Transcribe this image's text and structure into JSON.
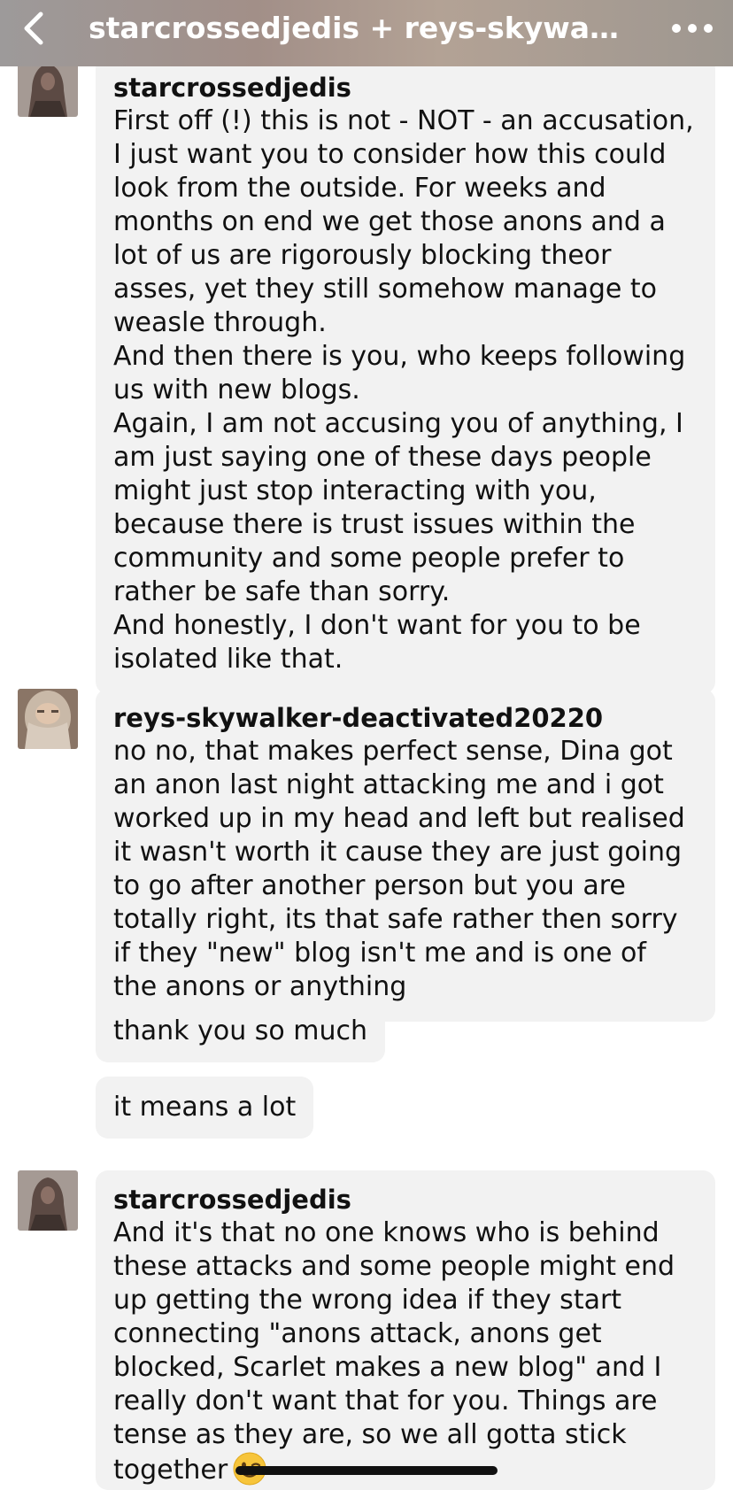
{
  "header": {
    "title": "starcrossedjedis + reys-skywalker-d...",
    "back_icon": "chevron-left-icon",
    "more_icon": "ellipsis-icon"
  },
  "messages": [
    {
      "sender": "starcrossedjedis",
      "avatar_icon": "hooded-figure-avatar",
      "text": "First off (!) this is not - NOT - an accusation, I just want you to consider how this could look from the outside. For weeks and months on end we get those anons and a lot of us are rigorously blocking theor asses, yet they still somehow manage to weasle through.\nAnd then there is you, who keeps following us with new blogs.\nAgain, I am not accusing you of anything, I am just saying one of these days people might just stop interacting with you, because there is trust issues within the community and some people prefer to rather be safe than sorry.\nAnd honestly, I don't want for you to be isolated like that."
    },
    {
      "sender": "reys-skywalker-deactivated20220",
      "avatar_icon": "veiled-face-avatar",
      "text": "no no, that makes perfect sense, Dina got an anon last night attacking me and i got worked up in my head and left but realised it wasn't worth it cause they are just going to go after another person but you are totally right, its that safe rather then sorry if they \"new\" blog isn't me and is one of the anons or anything"
    },
    {
      "text": "thank you so much"
    },
    {
      "text": "it means a lot"
    },
    {
      "sender": "starcrossedjedis",
      "avatar_icon": "hooded-figure-avatar",
      "text": "And it's that no one knows who is behind these attacks and some people might end up getting the wrong idea if they start connecting \"anons attack, anons get blocked, Scarlet makes a new blog\" and I really don't want that for you. Things are tense as they are, so we all gotta stick together",
      "emoji": "winking-face-emoji"
    }
  ],
  "colors": {
    "bubble": "#f2f2f2",
    "text": "#111111",
    "header_text": "#ffffff"
  }
}
